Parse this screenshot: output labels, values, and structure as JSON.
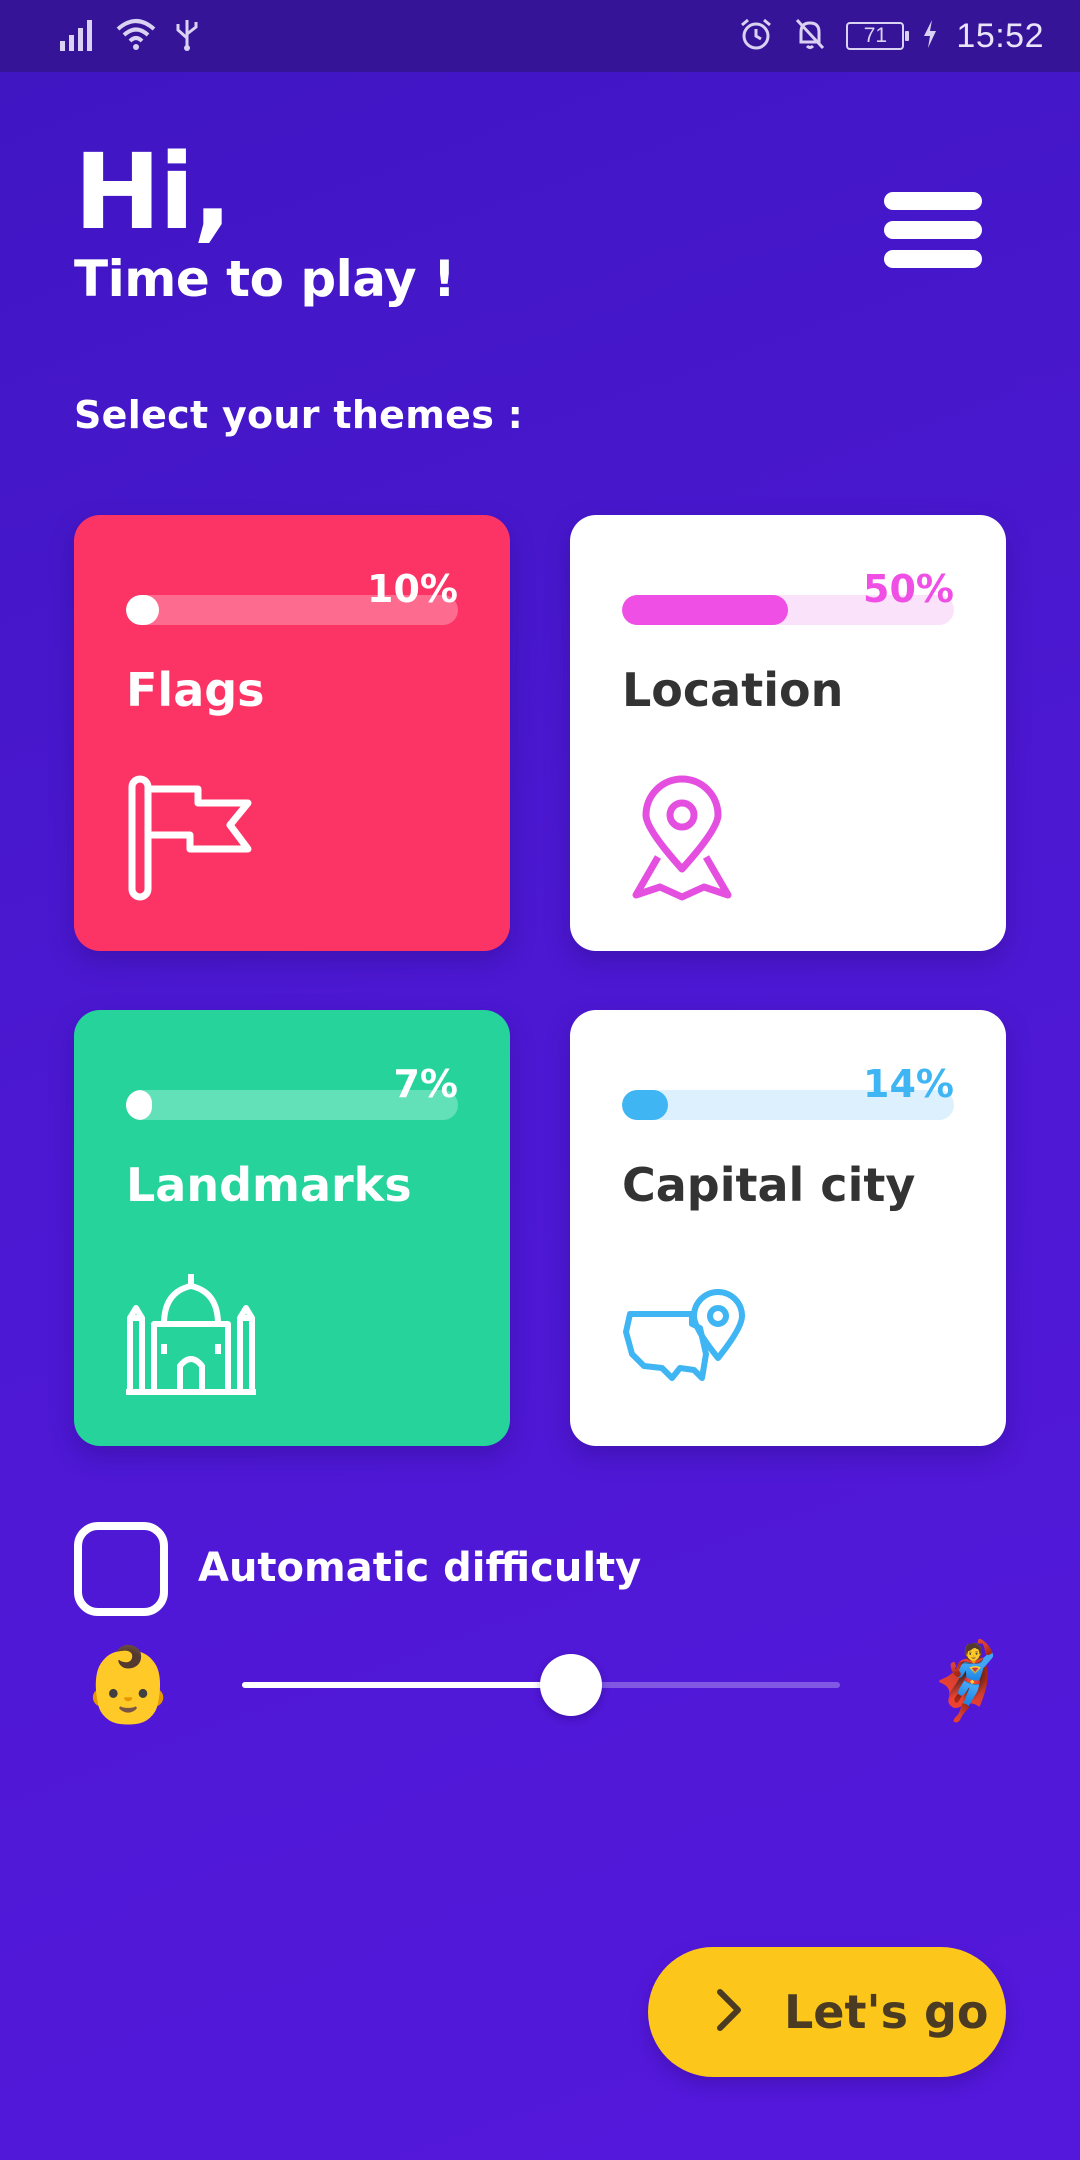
{
  "status_bar": {
    "time": "15:52",
    "battery": "71",
    "icons": [
      "signal-icon",
      "wifi-icon",
      "usb-icon",
      "alarm-icon",
      "mute-bell-icon",
      "battery-icon",
      "charging-icon"
    ]
  },
  "header": {
    "title": "Hi,",
    "subtitle": "Time to play !",
    "menu_icon": "hamburger-menu-icon"
  },
  "themes_label": "Select your themes :",
  "themes": [
    {
      "name": "Flags",
      "progress_label": "10%",
      "progress": 0.1,
      "color": "#fc3465",
      "icon": "flag-icon"
    },
    {
      "name": "Location",
      "progress_label": "50%",
      "progress": 0.5,
      "color": "#ef4fe4",
      "icon": "map-pin-icon"
    },
    {
      "name": "Landmarks",
      "progress_label": "7%",
      "progress": 0.07,
      "color": "#26d49b",
      "icon": "taj-mahal-icon"
    },
    {
      "name": "Capital city",
      "progress_label": "14%",
      "progress": 0.14,
      "color": "#3fb5f3",
      "icon": "country-map-pin-icon"
    }
  ],
  "difficulty": {
    "auto_label": "Automatic difficulty",
    "auto_checked": false,
    "easy_emoji": "👶",
    "hard_emoji": "🦸",
    "level": 0.55
  },
  "cta": {
    "label": "Let's go",
    "icon": "chevron-right-icon",
    "color": "#fdc61b"
  }
}
